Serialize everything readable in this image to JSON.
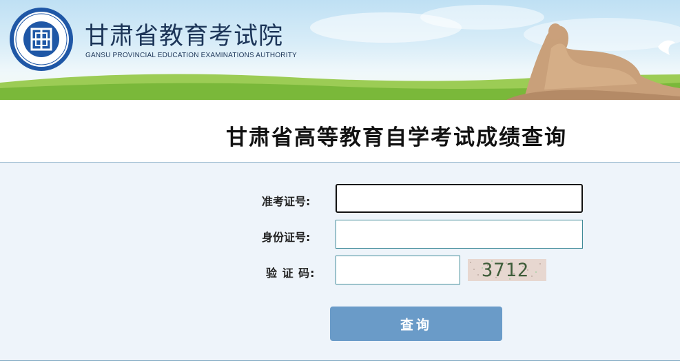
{
  "header": {
    "org_name": "甘肃省教育考试院",
    "org_name_en": "GANSU PROVINCIAL EDUCATION EXAMINATIONS AUTHORITY"
  },
  "page": {
    "title": "甘肃省高等教育自学考试成绩查询"
  },
  "form": {
    "admission_number": {
      "label": "准考证号:",
      "value": ""
    },
    "id_number": {
      "label": "身份证号:",
      "value": ""
    },
    "captcha": {
      "label": "验 证 码:",
      "value": "",
      "image_text": "3712"
    },
    "submit_label": "查询"
  },
  "colors": {
    "panel_background": "#eef4fa",
    "button": "#6a9bc8",
    "field_border": "#3f8a98"
  }
}
